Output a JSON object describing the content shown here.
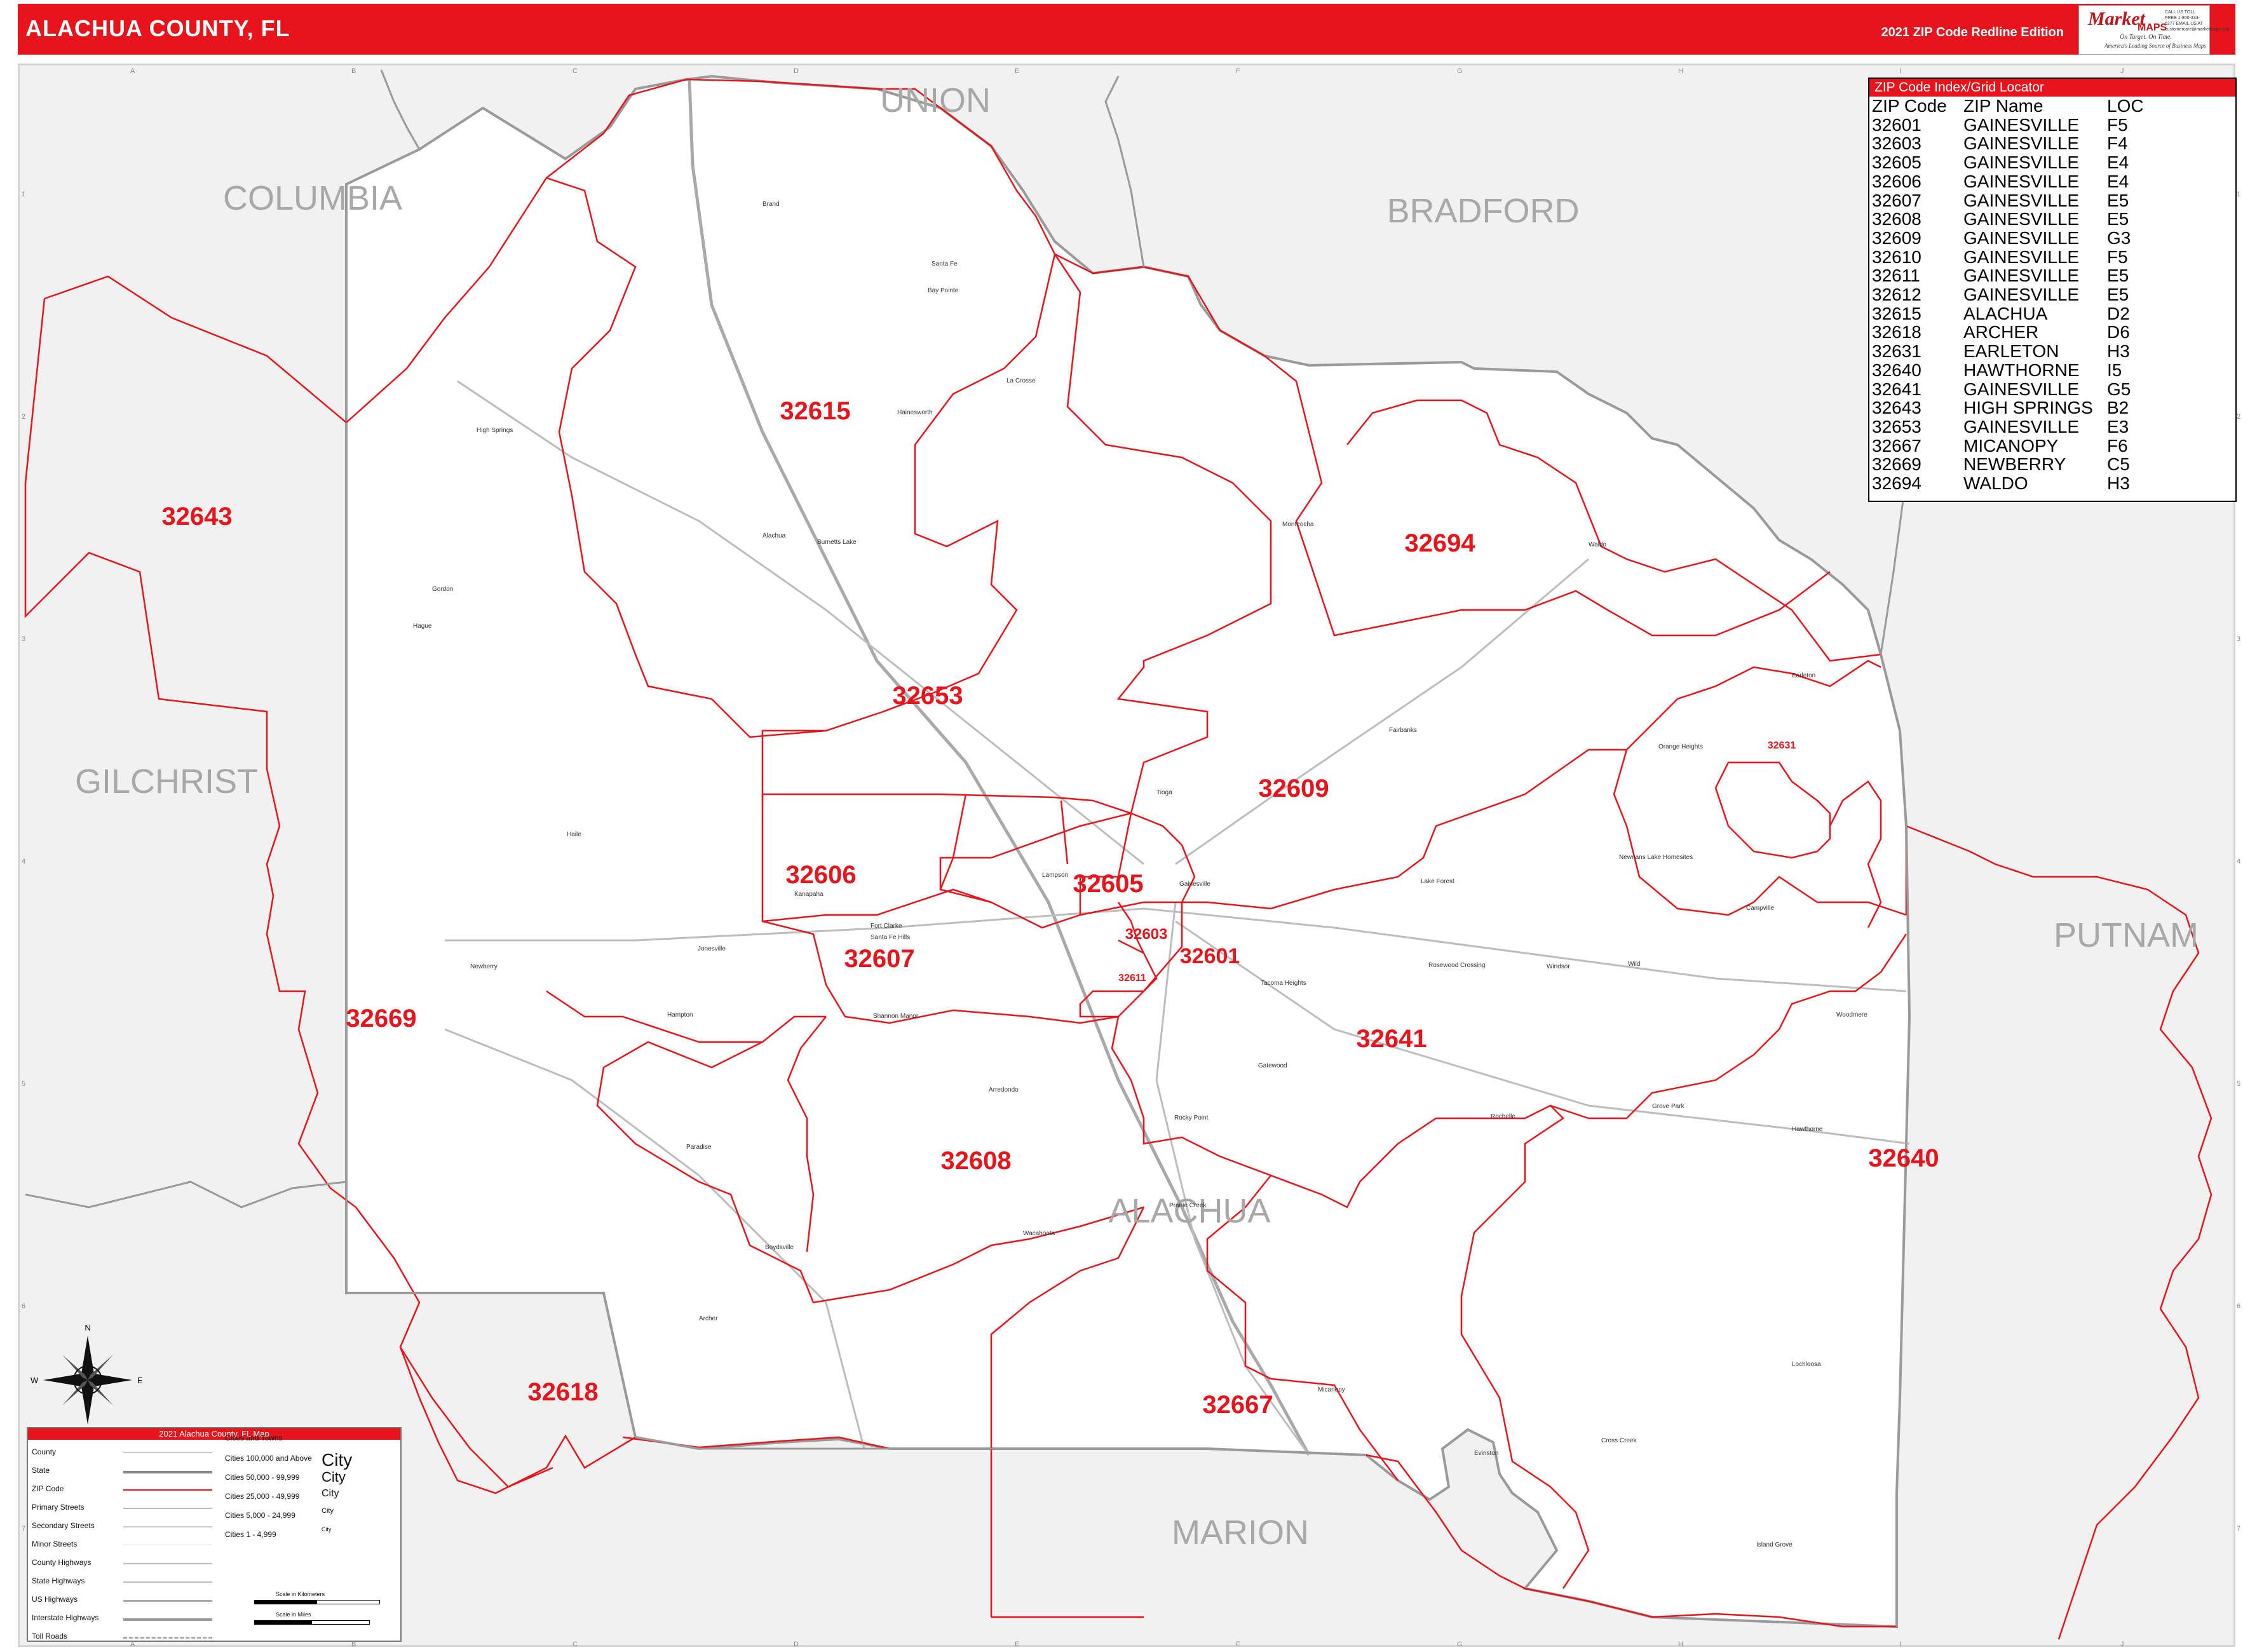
{
  "header": {
    "title": "ALACHUA COUNTY, FL",
    "edition": "2021 ZIP Code Redline Edition",
    "logo": {
      "brand_market": "Market",
      "brand_maps": "MAPS",
      "tagline1": "On Target. On Time.",
      "tagline2": "America's Leading Source of Business Maps",
      "contact": "CALL US TOLL FREE 1-800-334-6277 EMAIL US AT customercare@marketmaps.com"
    }
  },
  "grid": {
    "columns": [
      "A",
      "B",
      "C",
      "D",
      "E",
      "F",
      "G",
      "H",
      "I",
      "J"
    ],
    "rows": [
      "1",
      "2",
      "3",
      "4",
      "5",
      "6",
      "7"
    ]
  },
  "counties": {
    "surrounding": [
      "UNION",
      "COLUMBIA",
      "BRADFORD",
      "GILCHRIST",
      "PUTNAM",
      "MARION"
    ],
    "main": "ALACHUA"
  },
  "zip_labels": [
    "32615",
    "32643",
    "32694",
    "32653",
    "32609",
    "32606",
    "32605",
    "32603",
    "32601",
    "32611",
    "32607",
    "32669",
    "32641",
    "32608",
    "32640",
    "32618",
    "32667",
    "32631"
  ],
  "places": [
    "Gainesville",
    "High Springs",
    "Alachua",
    "Newberry",
    "Archer",
    "Micanopy",
    "Hawthorne",
    "Waldo",
    "Orange Heights",
    "Earleton",
    "La Crosse",
    "Santa Fe",
    "Brand",
    "Hainesworth",
    "Monteocha",
    "Fairbanks",
    "Campville",
    "Windsor",
    "Rochelle",
    "Grove Park",
    "Lochloosa",
    "Cross Creek",
    "Island Grove",
    "Evinston",
    "Rocky Point",
    "Wacahoota",
    "Arredondo",
    "Shannon Manor",
    "Haile",
    "Jonesville",
    "Fort Clarke",
    "Tioga",
    "Kanapaha",
    "Hague",
    "Santa Fe Hills",
    "Gordon",
    "Burnetts Lake",
    "Tacoma Heights",
    "Paradise",
    "Boydsville",
    "Lake Forest",
    "Gatewood",
    "Wild",
    "Hampton",
    "Lampson",
    "Rosewood Crossing",
    "Newnans Lake Homesites",
    "Woodmere",
    "Bay Pointe",
    "Prairie Creek"
  ],
  "zip_index": {
    "title": "ZIP Code Index/Grid Locator",
    "headers": [
      "ZIP Code",
      "ZIP Name",
      "LOC"
    ],
    "rows": [
      [
        "32601",
        "GAINESVILLE",
        "F5"
      ],
      [
        "32603",
        "GAINESVILLE",
        "F4"
      ],
      [
        "32605",
        "GAINESVILLE",
        "E4"
      ],
      [
        "32606",
        "GAINESVILLE",
        "E4"
      ],
      [
        "32607",
        "GAINESVILLE",
        "E5"
      ],
      [
        "32608",
        "GAINESVILLE",
        "E5"
      ],
      [
        "32609",
        "GAINESVILLE",
        "G3"
      ],
      [
        "32610",
        "GAINESVILLE",
        "F5"
      ],
      [
        "32611",
        "GAINESVILLE",
        "E5"
      ],
      [
        "32612",
        "GAINESVILLE",
        "E5"
      ],
      [
        "32615",
        "ALACHUA",
        "D2"
      ],
      [
        "32618",
        "ARCHER",
        "D6"
      ],
      [
        "32631",
        "EARLETON",
        "H3"
      ],
      [
        "32640",
        "HAWTHORNE",
        "I5"
      ],
      [
        "32641",
        "GAINESVILLE",
        "G5"
      ],
      [
        "32643",
        "HIGH SPRINGS",
        "B2"
      ],
      [
        "32653",
        "GAINESVILLE",
        "E3"
      ],
      [
        "32667",
        "MICANOPY",
        "F6"
      ],
      [
        "32669",
        "NEWBERRY",
        "C5"
      ],
      [
        "32694",
        "WALDO",
        "H3"
      ]
    ]
  },
  "legend": {
    "title": "2021 Alachua County, FL Map",
    "line_items": [
      "County",
      "State",
      "ZIP Code",
      "Primary Streets",
      "Secondary Streets",
      "Minor Streets",
      "County Highways",
      "State Highways",
      "US Highways",
      "Interstate Highways",
      "Toll Roads"
    ],
    "cities_title": "Cities and Towns",
    "cities": [
      {
        "range": "Cities 100,000 and Above",
        "sample": "City"
      },
      {
        "range": "Cities 50,000 - 99,999",
        "sample": "City"
      },
      {
        "range": "Cities 25,000 - 49,999",
        "sample": "City"
      },
      {
        "range": "Cities 5,000 - 24,999",
        "sample": "City"
      },
      {
        "range": "Cities 1 - 4,999",
        "sample": "City"
      }
    ],
    "scale_km": "Scale in Kilometers",
    "scale_mi": "Scale in Miles",
    "compass": {
      "n": "N",
      "s": "S",
      "e": "E",
      "w": "W"
    }
  },
  "colors": {
    "accent": "#e8141c",
    "zip_line": "#e8141c",
    "county_fill": "#f1f1f1",
    "county_label": "#a8a8a8"
  }
}
